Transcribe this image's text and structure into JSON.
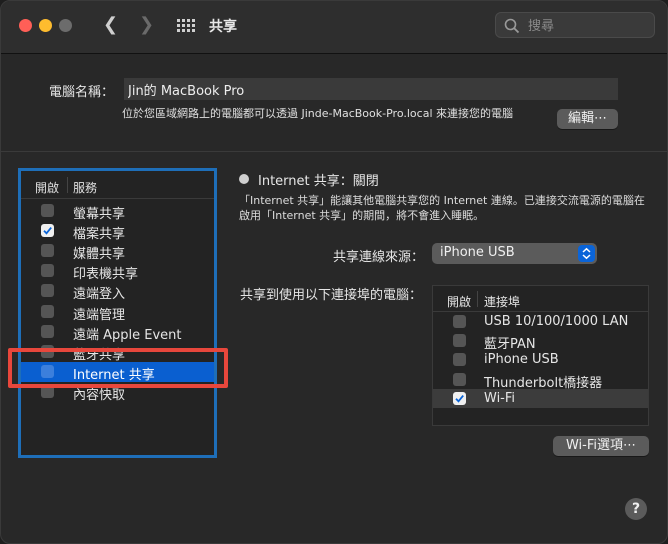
{
  "window": {
    "title": "共享"
  },
  "search": {
    "placeholder": "搜尋"
  },
  "computer_name": {
    "label": "電腦名稱：",
    "value": "Jin的 MacBook Pro",
    "hint": "位於您區域網路上的電腦都可以透過 Jinde-MacBook-Pro.local 來連接您的電腦",
    "edit_label": "編輯⋯"
  },
  "services": {
    "header_on": "開啟",
    "header_service": "服務",
    "items": [
      {
        "label": "螢幕共享",
        "checked": false,
        "selected": false
      },
      {
        "label": "檔案共享",
        "checked": true,
        "selected": false
      },
      {
        "label": "媒體共享",
        "checked": false,
        "selected": false
      },
      {
        "label": "印表機共享",
        "checked": false,
        "selected": false
      },
      {
        "label": "遠端登入",
        "checked": false,
        "selected": false
      },
      {
        "label": "遠端管理",
        "checked": false,
        "selected": false
      },
      {
        "label": "遠端 Apple Event",
        "checked": false,
        "selected": false
      },
      {
        "label": "藍牙共享",
        "checked": false,
        "selected": false
      },
      {
        "label": "Internet 共享",
        "checked": false,
        "selected": true
      },
      {
        "label": "內容快取",
        "checked": false,
        "selected": false
      }
    ]
  },
  "detail": {
    "status": "Internet 共享：關閉",
    "description": "「Internet 共享」能讓其他電腦共享您的 Internet 連線。已連接交流電源的電腦在啟用「Internet 共享」的期間，將不會進入睡眠。",
    "source_label": "共享連線來源：",
    "source_value": "iPhone USB",
    "to_label": "共享到使用以下連接埠的電腦：",
    "ports_header_on": "開啟",
    "ports_header_port": "連接埠",
    "ports": [
      {
        "label": "USB 10/100/1000 LAN",
        "checked": false
      },
      {
        "label": "藍牙PAN",
        "checked": false
      },
      {
        "label": "iPhone USB",
        "checked": false
      },
      {
        "label": "Thunderbolt橋接器",
        "checked": false
      },
      {
        "label": "Wi-Fi",
        "checked": true
      }
    ],
    "wifi_options_label": "Wi-Fi選項⋯"
  },
  "help_label": "?",
  "colors": {
    "accent": "#0a5fd0",
    "highlight": "#e8473c",
    "box_border": "#1e6eb8"
  }
}
